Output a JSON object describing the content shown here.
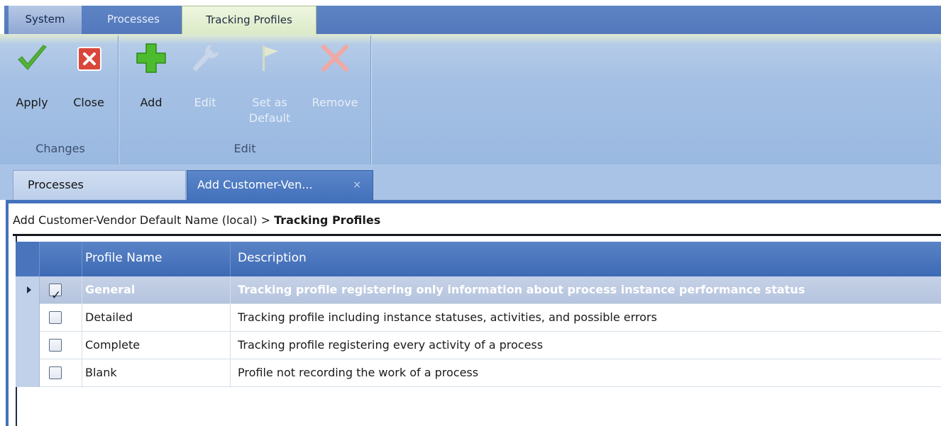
{
  "menu": {
    "tabs": [
      {
        "label": "System"
      },
      {
        "label": "Processes"
      },
      {
        "label": "Tracking Profiles",
        "active": true
      }
    ]
  },
  "ribbon": {
    "groups": [
      {
        "label": "Changes"
      },
      {
        "label": "Edit"
      }
    ],
    "buttons": {
      "apply": {
        "label": "Apply",
        "icon": "checkmark-icon",
        "enabled": true
      },
      "close": {
        "label": "Close",
        "icon": "close-box-icon",
        "enabled": true
      },
      "add": {
        "label": "Add",
        "icon": "plus-icon",
        "enabled": true
      },
      "edit": {
        "label": "Edit",
        "icon": "wrench-icon",
        "enabled": false
      },
      "set_default": {
        "label_line1": "Set as",
        "label_line2": "Default",
        "icon": "flag-icon",
        "enabled": false
      },
      "remove": {
        "label": "Remove",
        "icon": "x-icon",
        "enabled": false
      }
    }
  },
  "doc_tabs": [
    {
      "label": "Processes"
    },
    {
      "label": "Add Customer-Ven...",
      "active": true,
      "close": "×"
    }
  ],
  "breadcrumb": {
    "path": "Add Customer-Vendor Default Name (local) > ",
    "current": "Tracking Profiles"
  },
  "grid": {
    "columns": [
      "Profile Name",
      "Description"
    ],
    "rows": [
      {
        "checked": true,
        "name": "General",
        "description": "Tracking profile registering only information about process instance performance status",
        "selected": true
      },
      {
        "checked": false,
        "name": "Detailed",
        "description": "Tracking profile including instance statuses, activities, and possible errors"
      },
      {
        "checked": false,
        "name": "Complete",
        "description": "Tracking profile registering every activity of a process"
      },
      {
        "checked": false,
        "name": "Blank",
        "description": "Profile not recording the work of a process"
      }
    ]
  },
  "colors": {
    "ribbon": "#a5c0e4",
    "header": "#4371bb",
    "selected_row": "#bccae0",
    "apply_icon": "#4cae32",
    "close_icon": "#d9473b",
    "add_icon": "#4ab82e"
  }
}
